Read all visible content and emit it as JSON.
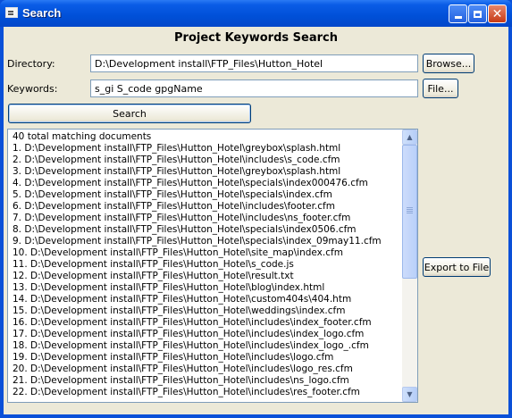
{
  "window": {
    "title": "Search"
  },
  "heading": "Project Keywords Search",
  "directory": {
    "label": "Directory:",
    "value": "D:\\Development install\\FTP_Files\\Hutton_Hotel",
    "browse_label": "Browse..."
  },
  "keywords": {
    "label": "Keywords:",
    "value": "s_gi S_code gpgName",
    "file_label": "File..."
  },
  "search_label": "Search",
  "export_label": "Export to File",
  "results": {
    "summary": "40 total matching documents",
    "lines": [
      "1. D:\\Development install\\FTP_Files\\Hutton_Hotel\\greybox\\splash.html",
      "2. D:\\Development install\\FTP_Files\\Hutton_Hotel\\includes\\s_code.cfm",
      "3. D:\\Development install\\FTP_Files\\Hutton_Hotel\\greybox\\splash.html",
      "4. D:\\Development install\\FTP_Files\\Hutton_Hotel\\specials\\index000476.cfm",
      "5. D:\\Development install\\FTP_Files\\Hutton_Hotel\\specials\\index.cfm",
      "6. D:\\Development install\\FTP_Files\\Hutton_Hotel\\includes\\footer.cfm",
      "7. D:\\Development install\\FTP_Files\\Hutton_Hotel\\includes\\ns_footer.cfm",
      "8. D:\\Development install\\FTP_Files\\Hutton_Hotel\\specials\\index0506.cfm",
      "9. D:\\Development install\\FTP_Files\\Hutton_Hotel\\specials\\index_09may11.cfm",
      "10. D:\\Development install\\FTP_Files\\Hutton_Hotel\\site_map\\index.cfm",
      "11. D:\\Development install\\FTP_Files\\Hutton_Hotel\\s_code.js",
      "12. D:\\Development install\\FTP_Files\\Hutton_Hotel\\result.txt",
      "13. D:\\Development install\\FTP_Files\\Hutton_Hotel\\blog\\index.html",
      "14. D:\\Development install\\FTP_Files\\Hutton_Hotel\\custom404s\\404.htm",
      "15. D:\\Development install\\FTP_Files\\Hutton_Hotel\\weddings\\index.cfm",
      "16. D:\\Development install\\FTP_Files\\Hutton_Hotel\\includes\\index_footer.cfm",
      "17. D:\\Development install\\FTP_Files\\Hutton_Hotel\\includes\\index_logo.cfm",
      "18. D:\\Development install\\FTP_Files\\Hutton_Hotel\\includes\\index_logo_.cfm",
      "19. D:\\Development install\\FTP_Files\\Hutton_Hotel\\includes\\logo.cfm",
      "20. D:\\Development install\\FTP_Files\\Hutton_Hotel\\includes\\logo_res.cfm",
      "21. D:\\Development install\\FTP_Files\\Hutton_Hotel\\includes\\ns_logo.cfm",
      "22. D:\\Development install\\FTP_Files\\Hutton_Hotel\\includes\\res_footer.cfm"
    ]
  },
  "icons": {
    "app": "app-window-icon",
    "minimize": "minimize-icon",
    "maximize": "maximize-icon",
    "close": "close-icon",
    "scroll_up": "scroll-up-arrow-icon",
    "scroll_down": "scroll-down-arrow-icon"
  },
  "colors": {
    "titlebar": "#0050d8",
    "dialog_bg": "#ece9d8",
    "field_border": "#7f9db9",
    "close_button": "#c63a16"
  }
}
